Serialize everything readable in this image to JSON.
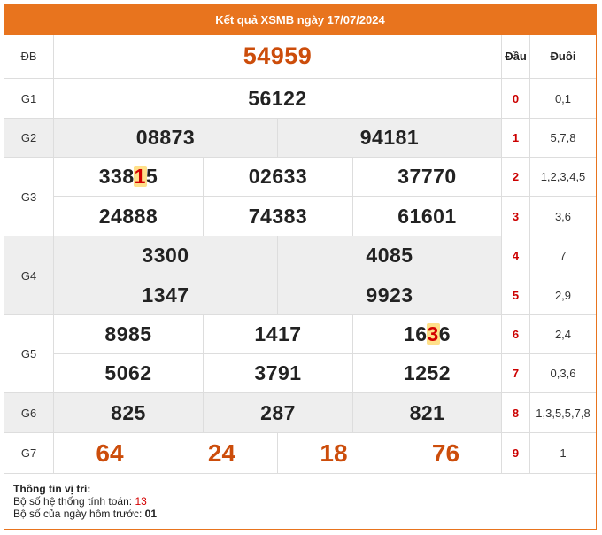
{
  "title": "Kết quả XSMB ngày 17/07/2024",
  "headers": {
    "dau": "Đầu",
    "duoi": "Đuôi"
  },
  "prizes": {
    "db": {
      "label": "ĐB",
      "numbers": [
        "54959"
      ]
    },
    "g1": {
      "label": "G1",
      "numbers": [
        "56122"
      ]
    },
    "g2": {
      "label": "G2",
      "numbers": [
        "08873",
        "94181"
      ]
    },
    "g3": {
      "label": "G3",
      "numbers": [
        "33815",
        "02633",
        "37770",
        "24888",
        "74383",
        "61601"
      ]
    },
    "g4": {
      "label": "G4",
      "numbers": [
        "3300",
        "4085",
        "1347",
        "9923"
      ]
    },
    "g5": {
      "label": "G5",
      "numbers": [
        "8985",
        "1417",
        "1636",
        "5062",
        "3791",
        "1252"
      ]
    },
    "g6": {
      "label": "G6",
      "numbers": [
        "825",
        "287",
        "821"
      ]
    },
    "g7": {
      "label": "G7",
      "numbers": [
        "64",
        "24",
        "18",
        "76"
      ]
    }
  },
  "highlights": {
    "g3_0": {
      "pre": "338",
      "hl": "1",
      "post": "5"
    },
    "g5_2": {
      "pre": "16",
      "hl": "3",
      "post": "6"
    }
  },
  "loto": [
    {
      "dau": "0",
      "duoi": "0,1"
    },
    {
      "dau": "1",
      "duoi": "5,7,8"
    },
    {
      "dau": "2",
      "duoi": "1,2,3,4,5"
    },
    {
      "dau": "3",
      "duoi": "3,6"
    },
    {
      "dau": "4",
      "duoi": "7"
    },
    {
      "dau": "5",
      "duoi": "2,9"
    },
    {
      "dau": "6",
      "duoi": "2,4"
    },
    {
      "dau": "7",
      "duoi": "0,3,6"
    },
    {
      "dau": "8",
      "duoi": "1,3,5,5,7,8"
    },
    {
      "dau": "9",
      "duoi": "1"
    }
  ],
  "info": {
    "heading": "Thông tin vị trí:",
    "line1_label": "Bộ số hệ thống tính toán: ",
    "line1_value": "13",
    "line2_label": "Bộ số của ngày hôm trước: ",
    "line2_value": "01"
  },
  "colors": {
    "accent": "#e8741e",
    "prize_red": "#cc4d0b",
    "dau_red": "#cc0000",
    "row_gray": "#eeeeee"
  }
}
